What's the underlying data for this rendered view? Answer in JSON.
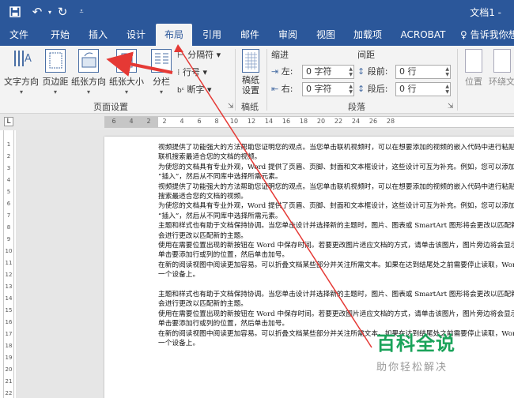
{
  "title_bar": {
    "doc_title": "文档1 -"
  },
  "tabs": [
    {
      "label": "文件"
    },
    {
      "label": "开始"
    },
    {
      "label": "插入"
    },
    {
      "label": "设计"
    },
    {
      "label": "布局"
    },
    {
      "label": "引用"
    },
    {
      "label": "邮件"
    },
    {
      "label": "审阅"
    },
    {
      "label": "视图"
    },
    {
      "label": "加载项"
    },
    {
      "label": "ACROBAT"
    },
    {
      "label": "告诉我你想"
    }
  ],
  "ribbon": {
    "page_setup": {
      "text_direction": "文字方向",
      "margins": "页边距",
      "orientation": "纸张方向",
      "size": "纸张大小",
      "columns": "分栏",
      "breaks": "分隔符",
      "line_numbers": "行号",
      "hyphenation": "断字",
      "group_label": "页面设置"
    },
    "draft": {
      "button": "稿纸\n设置",
      "group_label": "稿纸"
    },
    "paragraph": {
      "indent_label": "缩进",
      "spacing_label": "间距",
      "left_label": "左:",
      "right_label": "右:",
      "left_value": "0 字符",
      "right_value": "0 字符",
      "before_label": "段前:",
      "after_label": "段后:",
      "before_value": "0 行",
      "after_value": "0 行",
      "group_label": "段落"
    },
    "arrange": {
      "position": "位置",
      "wrap": "环绕文字"
    }
  },
  "ruler": {
    "numbers": [
      "6",
      "4",
      "2",
      "2",
      "4",
      "6",
      "8",
      "10",
      "12",
      "14",
      "16",
      "18",
      "20",
      "22",
      "24",
      "26",
      "28"
    ]
  },
  "vruler": {
    "numbers": [
      "1",
      "2",
      "3",
      "4",
      "5",
      "6",
      "7",
      "8",
      "9",
      "10",
      "11",
      "12",
      "13",
      "14",
      "15",
      "16",
      "17",
      "18",
      "19",
      "20",
      "21",
      "22"
    ]
  },
  "document": {
    "paragraphs": [
      "视频提供了功能强大的方法帮助您证明您的观点。当您单击联机视频时，可以在想要添加的视频的嵌入代码中进行粘贴。您也可以键入一个关键字以",
      "联机搜索最适合您的文档的视频。",
      "为使您的文档具有专业外观，Word 提供了页眉、页脚、封面和文本框设计，这些设计可互为补充。例如，您可以添加匹配的封面、页眉和提要栏。单击",
      "“插入”，然后从不同库中选择所需元素。",
      "视频提供了功能强大的方法帮助您证明您的观点。当您单击联机视频时，可以在想要添加的视频的嵌入代码中进行粘贴。您也可以键入一个关键字以联机",
      "搜索最适合您的文档的视频。",
      "为使您的文档具有专业外观，Word 提供了页眉、页脚、封面和文本框设计，这些设计可互为补充。例如，您可以添加匹配的封面、页眉和提要栏。单击",
      "“插入”，然后从不同库中选择所需元素。",
      "主题和样式也有助于文档保持协调。当您单击设计并选择新的主题时，图片、图表或 SmartArt 图形将会更改以匹配新的主题。当应用样式时，您的标题",
      "会进行更改以匹配新的主题。",
      "使用在需要位置出现的新按钮在 Word 中保存时间。若要更改图片适应文档的方式，请单击该图片，图片旁边将会显示布局选项按钮。当处理表格时，",
      "单击要添加行或列的位置，然后单击加号。",
      "在新的阅读视图中阅读更加容易。可以折叠文档某些部分并关注所需文本。如果在达到结尾处之前需要停止读取，Word 会记住您的停止位置 - 即使在另",
      "一个设备上。",
      "",
      "主题和样式也有助于文档保持协调。当您单击设计并选择新的主题时，图片、图表或 SmartArt 图形将会更改以匹配新的主题。当应用样式时，您的标题",
      "会进行更改以匹配新的主题。",
      "使用在需要位置出现的新按钮在 Word 中保存时间。若要更改图片适应文档的方式，请单击该图片，图片旁边将会显示布局选项按钮。当处理表格时，",
      "单击要添加行或列的位置，然后单击加号。",
      "在新的阅读视图中阅读更加容易。可以折叠文档某些部分并关注所需文本。如果在达到结尾处之前需要停止读取，Word 会记住您的停止位置 - 即使在另",
      "一个设备上。"
    ]
  },
  "watermark": {
    "logo": "百科全说",
    "tagline": "助你轻松解决"
  },
  "colors": {
    "titlebar": "#2b579a",
    "arrow": "#e53935",
    "watermark_green": "#1aa35a"
  }
}
